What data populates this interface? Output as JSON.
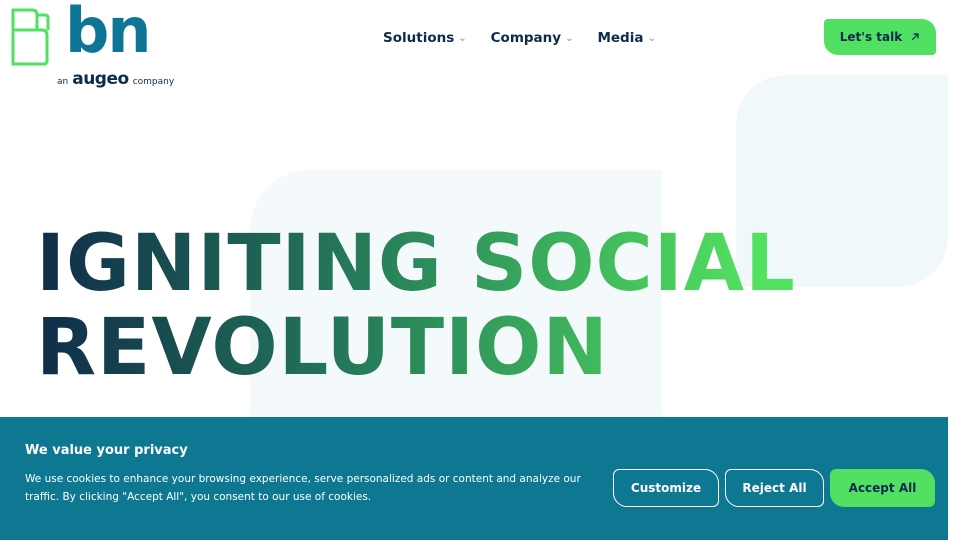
{
  "header": {
    "logo": {
      "wordmark": "bn",
      "prefix": "an",
      "brand": "augeo",
      "suffix": "company"
    },
    "nav": [
      {
        "label": "Solutions",
        "icon": "chevron-down-icon"
      },
      {
        "label": "Company",
        "icon": "chevron-down-icon"
      },
      {
        "label": "Media",
        "icon": "chevron-down-icon"
      }
    ],
    "cta": {
      "label": "Let's talk",
      "icon": "arrow-up-right-icon"
    }
  },
  "hero": {
    "title_line1": "IGNITING SOCIAL",
    "title_line2": "REVOLUTION"
  },
  "cookie_banner": {
    "title": "We value your privacy",
    "body": "We use cookies to enhance your browsing experience, serve personalized ads or content and analyze our traffic. By clicking \"Accept All\", you consent to our use of cookies.",
    "buttons": {
      "customize": "Customize",
      "reject": "Reject All",
      "accept": "Accept All"
    }
  },
  "colors": {
    "brand_blue": "#0f7597",
    "brand_green": "#52e063",
    "navy": "#0d2b4e",
    "banner_bg": "#0e7893"
  }
}
